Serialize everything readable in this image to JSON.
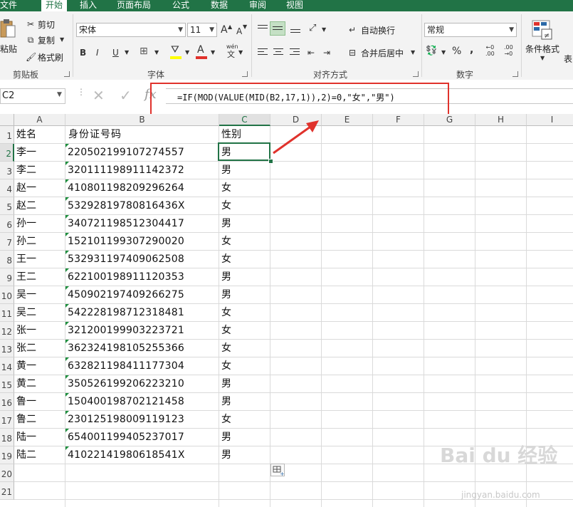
{
  "ribbon": {
    "tabs": [
      "文件",
      "开始",
      "插入",
      "页面布局",
      "公式",
      "数据",
      "审阅",
      "视图"
    ],
    "active_tab": "开始",
    "clipboard": {
      "paste": "粘贴",
      "cut": "剪切",
      "copy": "复制",
      "format_painter": "格式刷",
      "label": "剪贴板"
    },
    "font": {
      "name": "宋体",
      "size": "11",
      "grow": "A",
      "shrink": "A",
      "bold": "B",
      "italic": "I",
      "underline": "U",
      "wen": "wén",
      "wen_char": "文",
      "font_color_glyph": "A",
      "label": "字体"
    },
    "alignment": {
      "wrap": "自动换行",
      "merge": "合并后居中",
      "label": "对齐方式"
    },
    "number": {
      "format": "常规",
      "percent": "%",
      "comma": ",",
      "label": "数字"
    },
    "styles": {
      "cond_format": "条件格式",
      "table": "表"
    }
  },
  "formula_bar": {
    "name_box": "C2",
    "fx": "fx",
    "formula": "=IF(MOD(VALUE(MID(B2,17,1)),2)=0,\"女\",\"男\")"
  },
  "sheet": {
    "columns": [
      "A",
      "B",
      "C",
      "D",
      "E",
      "F",
      "G",
      "H",
      "I"
    ],
    "row_numbers": [
      "1",
      "2",
      "3",
      "4",
      "5",
      "6",
      "7",
      "8",
      "9",
      "10",
      "11",
      "12",
      "13",
      "14",
      "15",
      "16",
      "17",
      "18",
      "19",
      "20",
      "21"
    ],
    "header": {
      "name": "姓名",
      "id": "身份证号码",
      "gender": "性别"
    },
    "rows": [
      {
        "name": "李一",
        "id": "220502199107274557",
        "gender": "男"
      },
      {
        "name": "李二",
        "id": "320111198911142372",
        "gender": "男"
      },
      {
        "name": "赵一",
        "id": "410801198209296264",
        "gender": "女"
      },
      {
        "name": "赵二",
        "id": "53292819780816436X",
        "gender": "女"
      },
      {
        "name": "孙一",
        "id": "340721198512304417",
        "gender": "男"
      },
      {
        "name": "孙二",
        "id": "152101199307290020",
        "gender": "女"
      },
      {
        "name": "王一",
        "id": "532931197409062508",
        "gender": "女"
      },
      {
        "name": "王二",
        "id": "622100198911120353",
        "gender": "男"
      },
      {
        "name": "吴一",
        "id": "450902197409266275",
        "gender": "男"
      },
      {
        "name": "吴二",
        "id": "542228198712318481",
        "gender": "女"
      },
      {
        "name": "张一",
        "id": "321200199903223721",
        "gender": "女"
      },
      {
        "name": "张二",
        "id": "362324198105255366",
        "gender": "女"
      },
      {
        "name": "黄一",
        "id": "632821198411177304",
        "gender": "女"
      },
      {
        "name": "黄二",
        "id": "350526199206223210",
        "gender": "男"
      },
      {
        "name": "鲁一",
        "id": "150400198702121458",
        "gender": "男"
      },
      {
        "name": "鲁二",
        "id": "230125198009119123",
        "gender": "女"
      },
      {
        "name": "陆一",
        "id": "654001199405237017",
        "gender": "男"
      },
      {
        "name": "陆二",
        "id": "41022141980618541X",
        "gender": "男"
      }
    ]
  },
  "watermark": {
    "main": "Bai du 经验",
    "url": "jingyan.baidu.com"
  },
  "colors": {
    "accent": "#217346",
    "annotation": "#e0322c",
    "text_flag": "#1e8f3e"
  }
}
